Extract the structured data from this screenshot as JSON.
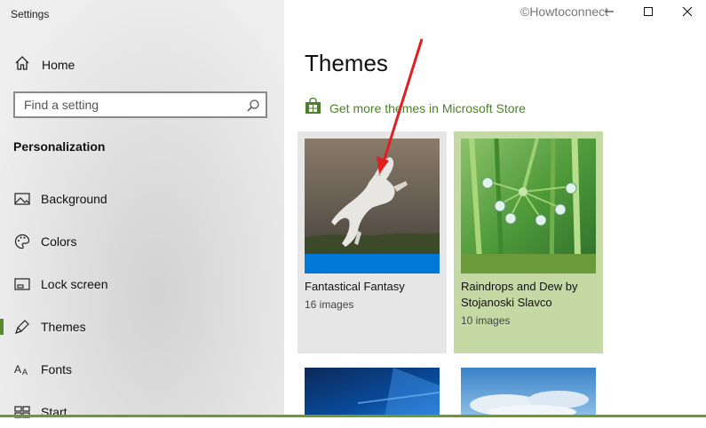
{
  "window": {
    "title": "Settings",
    "watermark": "©Howtoconnect",
    "controls": [
      "minimize",
      "maximize",
      "close"
    ]
  },
  "sidebar": {
    "home_label": "Home",
    "search_placeholder": "Find a setting",
    "section_title": "Personalization",
    "items": [
      {
        "label": "Background",
        "icon": "picture-icon"
      },
      {
        "label": "Colors",
        "icon": "palette-icon"
      },
      {
        "label": "Lock screen",
        "icon": "lock-screen-icon"
      },
      {
        "label": "Themes",
        "icon": "brush-icon",
        "selected": true
      },
      {
        "label": "Fonts",
        "icon": "fonts-icon"
      },
      {
        "label": "Start",
        "icon": "start-icon"
      }
    ]
  },
  "main": {
    "title": "Themes",
    "store_link": "Get more themes in Microsoft Store",
    "themes": [
      {
        "name": "Fantastical Fantasy",
        "count": "16 images",
        "accent": "#0078d7",
        "selected": true
      },
      {
        "name": "Raindrops and Dew by Stojanoski Slavco",
        "count": "10 images",
        "accent": "#6b9a3a"
      },
      {
        "name": "",
        "count": ""
      },
      {
        "name": "",
        "count": ""
      }
    ]
  },
  "colors": {
    "accent_green": "#5a8a2e",
    "link_green": "#4d7f2b",
    "annotation_red": "#e02020"
  }
}
